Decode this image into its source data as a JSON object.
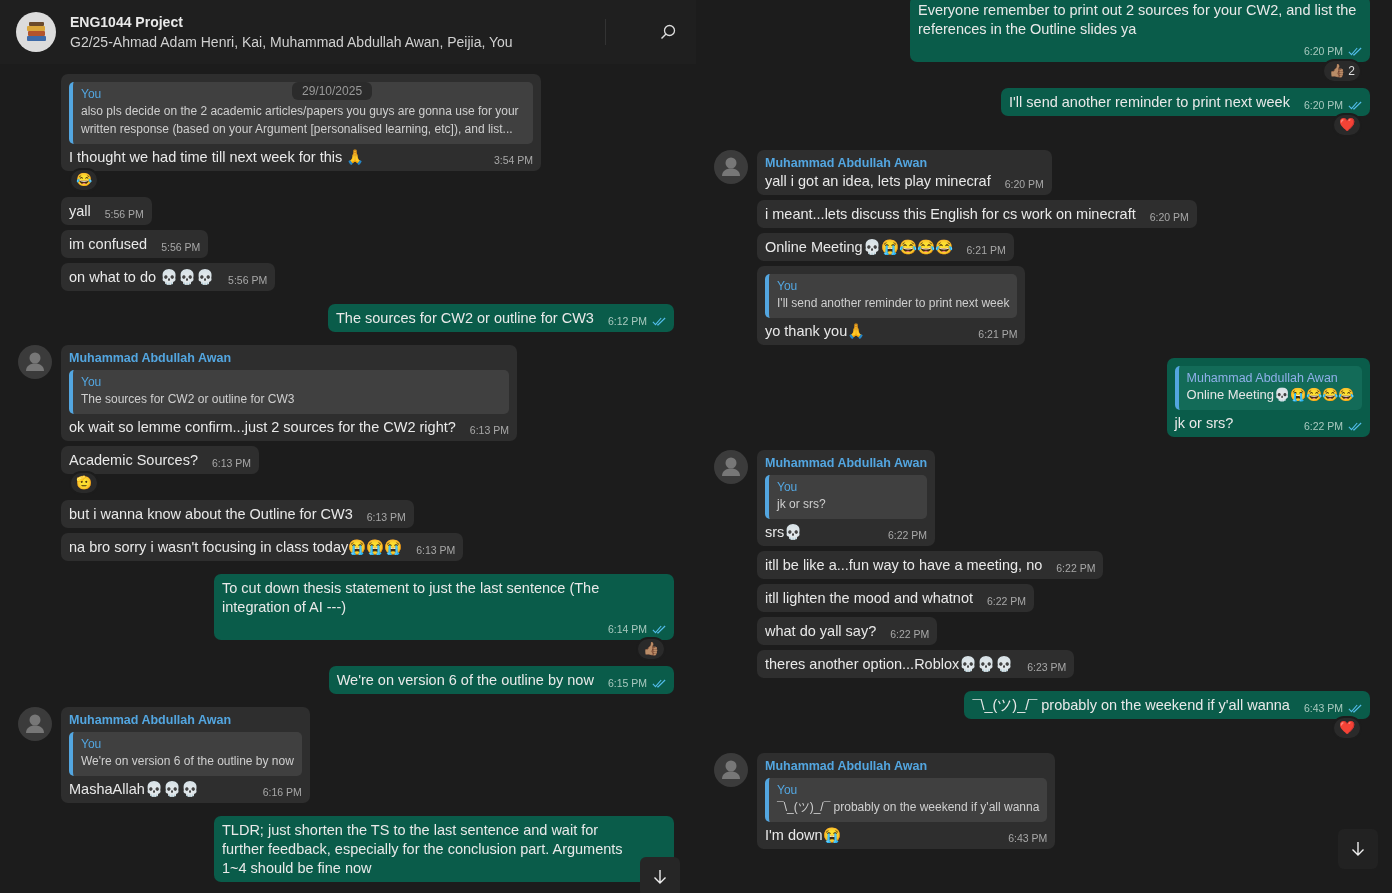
{
  "header": {
    "title": "ENG1044 Project",
    "subtitle": "G2/25-Ahmad Adam Henri, Kai, Muhammad Abdullah Awan, Peijia, You"
  },
  "date_chip": "29/10/2025",
  "left_pane": {
    "messages": [
      {
        "kind": "incoming",
        "quote": {
          "author": "You",
          "text": "also pls decide on the 2 academic articles/papers you guys are gonna use for your written response (based on your Argument [personalised learning, etc]), and list..."
        },
        "text": "I thought we had time till next week for this 🙏",
        "time": "3:54 PM",
        "reaction": {
          "emoji": "😂"
        }
      },
      {
        "kind": "incoming",
        "text": "yall",
        "time": "5:56 PM"
      },
      {
        "kind": "incoming",
        "text": "im confused",
        "time": "5:56 PM"
      },
      {
        "kind": "incoming",
        "text": "on what to do 💀💀💀",
        "time": "5:56 PM"
      },
      {
        "kind": "outgoing",
        "text": "The sources for CW2 or outline for CW3",
        "time": "6:12 PM",
        "read": true
      },
      {
        "kind": "incoming",
        "sender": "Muhammad Abdullah Awan",
        "quote": {
          "author": "You",
          "text": "The sources for CW2 or outline for CW3"
        },
        "text": "ok wait so lemme confirm...just 2 sources for the CW2 right?",
        "time": "6:13 PM"
      },
      {
        "kind": "incoming",
        "text": "Academic Sources?",
        "time": "6:13 PM",
        "reaction": {
          "emoji": "🫡"
        }
      },
      {
        "kind": "incoming",
        "text": "but i wanna know about the Outline for CW3",
        "time": "6:13 PM"
      },
      {
        "kind": "incoming",
        "text": "na bro sorry i wasn't focusing in class today😭😭😭",
        "time": "6:13 PM"
      },
      {
        "kind": "outgoing",
        "text": "To cut down thesis statement to just the last sentence (The integration of AI ---)",
        "time": "6:14 PM",
        "read": true,
        "reaction": {
          "emoji": "👍🏽"
        }
      },
      {
        "kind": "outgoing",
        "text": "We're on version 6 of the outline by now",
        "time": "6:15 PM",
        "read": true
      },
      {
        "kind": "incoming",
        "sender": "Muhammad Abdullah Awan",
        "quote": {
          "author": "You",
          "text": "We're on version 6 of the outline by now"
        },
        "text": "MashaAllah💀💀💀",
        "time": "6:16 PM"
      },
      {
        "kind": "outgoing",
        "text": "TLDR; just shorten the TS to the last sentence and wait for further feedback, especially for the conclusion part. Arguments 1~4 should be fine now"
      }
    ]
  },
  "right_pane": {
    "messages": [
      {
        "kind": "outgoing",
        "text": "Everyone remember to print out 2 sources for your CW2, and list the references in the Outline slides ya",
        "time": "6:20 PM",
        "read": true,
        "reaction": {
          "emoji": "👍🏽",
          "count": "2"
        }
      },
      {
        "kind": "outgoing",
        "text": "I'll send another reminder to print next week",
        "time": "6:20 PM",
        "read": true,
        "reaction": {
          "emoji": "❤️"
        }
      },
      {
        "kind": "incoming",
        "sender": "Muhammad Abdullah Awan",
        "text": "yall i got an idea, lets play minecraf",
        "time": "6:20 PM"
      },
      {
        "kind": "incoming",
        "text": "i meant...lets discuss this English for cs work on minecraft",
        "time": "6:20 PM"
      },
      {
        "kind": "incoming",
        "text": "Online Meeting💀😭😂😂😂",
        "time": "6:21 PM"
      },
      {
        "kind": "incoming",
        "quote": {
          "author": "You",
          "text": "I'll send another reminder to print next week"
        },
        "text": "yo thank you🙏",
        "time": "6:21 PM"
      },
      {
        "kind": "outgoing",
        "quote": {
          "author": "Muhammad Abdullah Awan",
          "text": "Online Meeting💀😭😂😂😂"
        },
        "text": "jk or srs?",
        "time": "6:22 PM",
        "read": true
      },
      {
        "kind": "incoming",
        "sender": "Muhammad Abdullah Awan",
        "quote": {
          "author": "You",
          "text": "jk or srs?"
        },
        "text": "srs💀",
        "time": "6:22 PM"
      },
      {
        "kind": "incoming",
        "text": "itll be like a...fun way to have a meeting, no",
        "time": "6:22 PM"
      },
      {
        "kind": "incoming",
        "text": "itll lighten the mood and whatnot",
        "time": "6:22 PM"
      },
      {
        "kind": "incoming",
        "text": "what do yall say?",
        "time": "6:22 PM"
      },
      {
        "kind": "incoming",
        "text": "theres another option...Roblox💀💀💀",
        "time": "6:23 PM"
      },
      {
        "kind": "outgoing",
        "text": "¯\\_(ツ)_/¯ probably on the weekend if y'all wanna",
        "time": "6:43 PM",
        "read": true,
        "reaction": {
          "emoji": "❤️"
        }
      },
      {
        "kind": "incoming",
        "sender": "Muhammad Abdullah Awan",
        "quote": {
          "author": "You",
          "text": "¯\\_(ツ)_/¯ probably on the weekend if y'all wanna"
        },
        "text": "I'm down😭",
        "time": "6:43 PM"
      }
    ]
  }
}
